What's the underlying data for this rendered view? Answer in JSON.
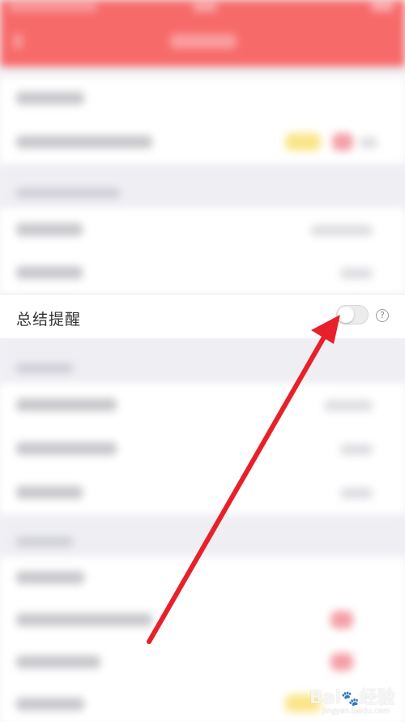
{
  "focused_setting": {
    "label": "总结提醒",
    "toggle_state": "off",
    "help_icon_glyph": "?"
  },
  "annotation": {
    "arrow_color": "#e8202a"
  },
  "theme": {
    "header_color": "#f76a6a",
    "background": "#f3f3f5"
  },
  "watermark": {
    "brand": "Bai",
    "brand_cn": "经验",
    "url": "jingyan.baidu.com"
  }
}
